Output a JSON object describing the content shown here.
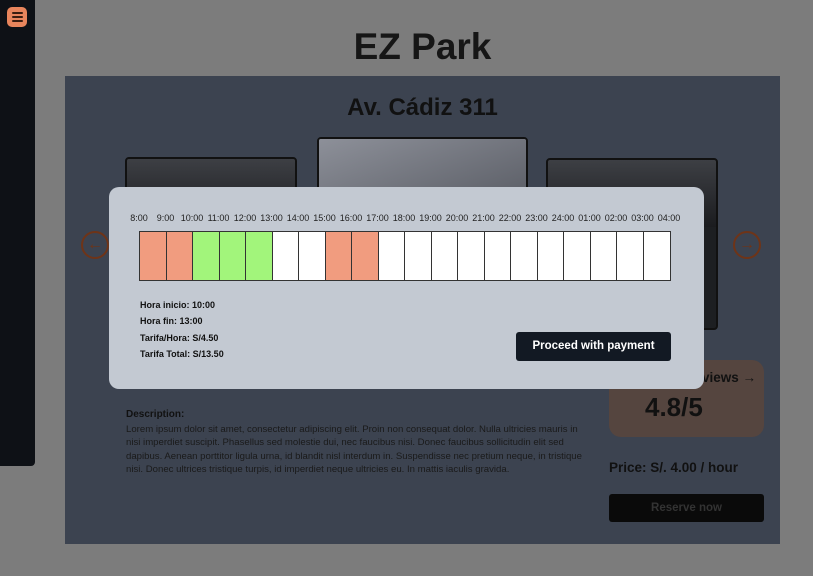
{
  "app": {
    "title": "EZ Park"
  },
  "sidebar": {
    "menu_icon": "hamburger-menu-icon",
    "accent": "#e8855c"
  },
  "listing": {
    "address": "Av. Cádiz 311",
    "description_title": "Description:",
    "description": "Lorem ipsum dolor sit amet, consectetur adipiscing elit. Proin non consequat dolor. Nulla ultricies mauris in nisi imperdiet suscipit. Phasellus sed molestie dui, nec faucibus nisi. Donec faucibus sollicitudin elit sed dapibus. Aenean porttitor ligula urna, id blandit nisl interdum in. Suspendisse nec pretium neque, in tristique nisi. Donec ultrices tristique turpis, id imperdiet neque ultricies eu. In mattis iaculis gravida.",
    "reviews_label": "views",
    "rating": "4.8/5",
    "price": "Price: S/. 4.00 / hour",
    "reserve_label": "Reserve now",
    "prev_icon": "arrow-left-circle-icon",
    "next_icon": "arrow-right-circle-icon"
  },
  "modal": {
    "hours": [
      "8:00",
      "9:00",
      "10:00",
      "11:00",
      "12:00",
      "13:00",
      "14:00",
      "15:00",
      "16:00",
      "17:00",
      "18:00",
      "19:00",
      "20:00",
      "21:00",
      "22:00",
      "23:00",
      "24:00",
      "01:00",
      "02:00",
      "03:00",
      "04:00"
    ],
    "slots": [
      "booked",
      "booked",
      "selected",
      "selected",
      "selected",
      "free",
      "free",
      "booked",
      "booked",
      "free",
      "free",
      "free",
      "free",
      "free",
      "free",
      "free",
      "free",
      "free",
      "free",
      "free"
    ],
    "colors": {
      "booked": "#f19c7f",
      "selected": "#a2f57b",
      "free": "#ffffff"
    },
    "start": "Hora inicio: 10:00",
    "end": "Hora fin: 13:00",
    "rate": "Tarifa/Hora: S/4.50",
    "total": "Tarifa Total: S/13.50",
    "pay_label": "Proceed with payment"
  }
}
